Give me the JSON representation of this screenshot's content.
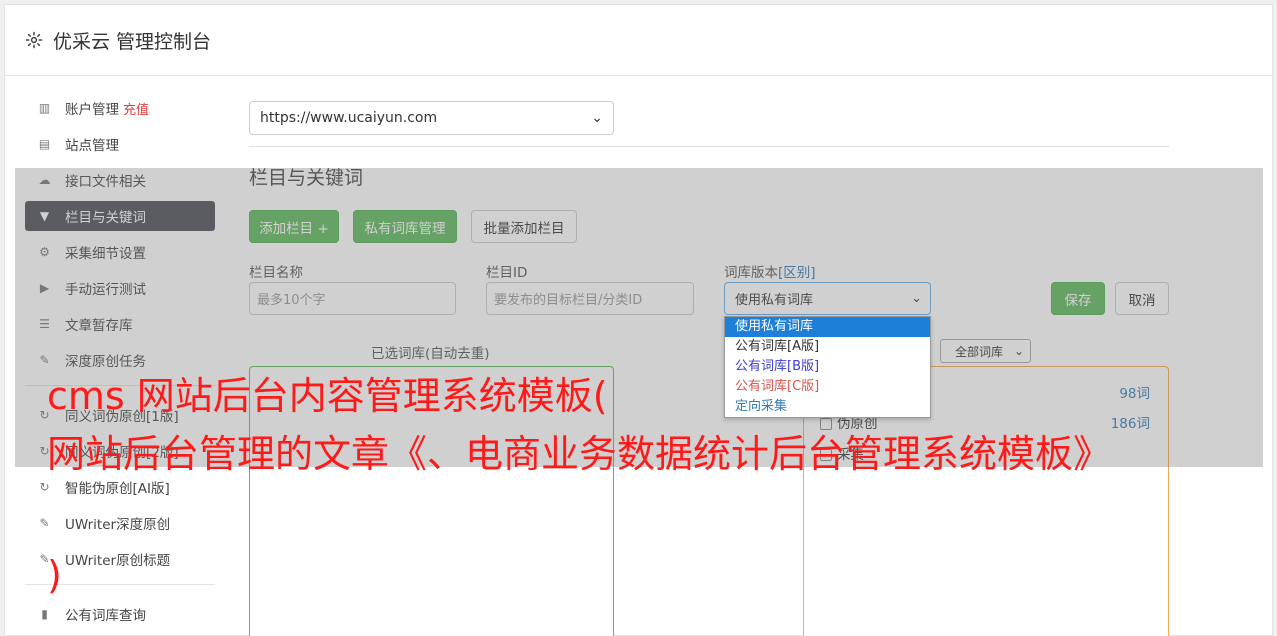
{
  "header": {
    "title": "优采云 管理控制台",
    "icon": "gear-icon"
  },
  "sidebar": {
    "items": [
      {
        "label": "账户管理",
        "badge": "充值",
        "icon": "bar-chart-icon",
        "active": false
      },
      {
        "label": "站点管理",
        "icon": "server-icon",
        "active": false
      },
      {
        "label": "接口文件相关",
        "icon": "cloud-upload-icon",
        "active": false
      },
      {
        "label": "栏目与关键词",
        "icon": "filter-icon",
        "active": true
      },
      {
        "label": "采集细节设置",
        "icon": "cogs-icon",
        "active": false
      },
      {
        "label": "手动运行测试",
        "icon": "play-circle-icon",
        "active": false
      },
      {
        "label": "文章暂存库",
        "icon": "database-icon",
        "active": false
      },
      {
        "label": "深度原创任务",
        "icon": "edit-icon",
        "active": false
      },
      {
        "label": "同义词伪原创[1版]",
        "icon": "refresh-icon",
        "active": false
      },
      {
        "label": "同义词伪原创[2版]",
        "icon": "refresh-icon",
        "active": false
      },
      {
        "label": "智能伪原创[AI版]",
        "icon": "refresh-icon",
        "active": false
      },
      {
        "label": "UWriter深度原创",
        "icon": "edit-icon",
        "active": false
      },
      {
        "label": "UWriter原创标题",
        "icon": "edit-icon",
        "active": false
      },
      {
        "label": "公有词库查询",
        "icon": "book-icon",
        "active": false
      }
    ]
  },
  "main": {
    "site_select": "https://www.ucaiyun.com",
    "section_title": "栏目与关键词",
    "buttons": {
      "add_column": "添加栏目 +",
      "private_lib": "私有词库管理",
      "batch_add": "批量添加栏目",
      "save": "保存",
      "cancel": "取消"
    },
    "form": {
      "name_label": "栏目名称",
      "name_placeholder": "最多10个字",
      "id_label": "栏目ID",
      "id_placeholder": "要发布的目标栏目/分类ID",
      "version_label": "词库版本",
      "version_link": "[区别]",
      "version_value": "使用私有词库"
    },
    "dropdown_options": [
      "使用私有词库",
      "公有词库[A版]",
      "公有词库[B版]",
      "公有词库[C版]",
      "定向采集"
    ],
    "selected_label": "已选词库(自动去重)",
    "lib_filter": "全部词库",
    "libraries": [
      {
        "name": "",
        "count": "98词"
      },
      {
        "name": "伪原创",
        "count": "186词"
      },
      {
        "name": "采集",
        "count": ""
      }
    ]
  },
  "watermark": {
    "line1": "cms 网站后台内容管理系统模板(",
    "line2": "网站后台管理的文章《、电商业务数据统计后台管理系统模板》",
    "line3": ")"
  },
  "colors": {
    "accent_green": "#5cb85c",
    "active_nav": "#4a4e57",
    "watermark": "#ff1a1a",
    "link": "#337ab7"
  }
}
